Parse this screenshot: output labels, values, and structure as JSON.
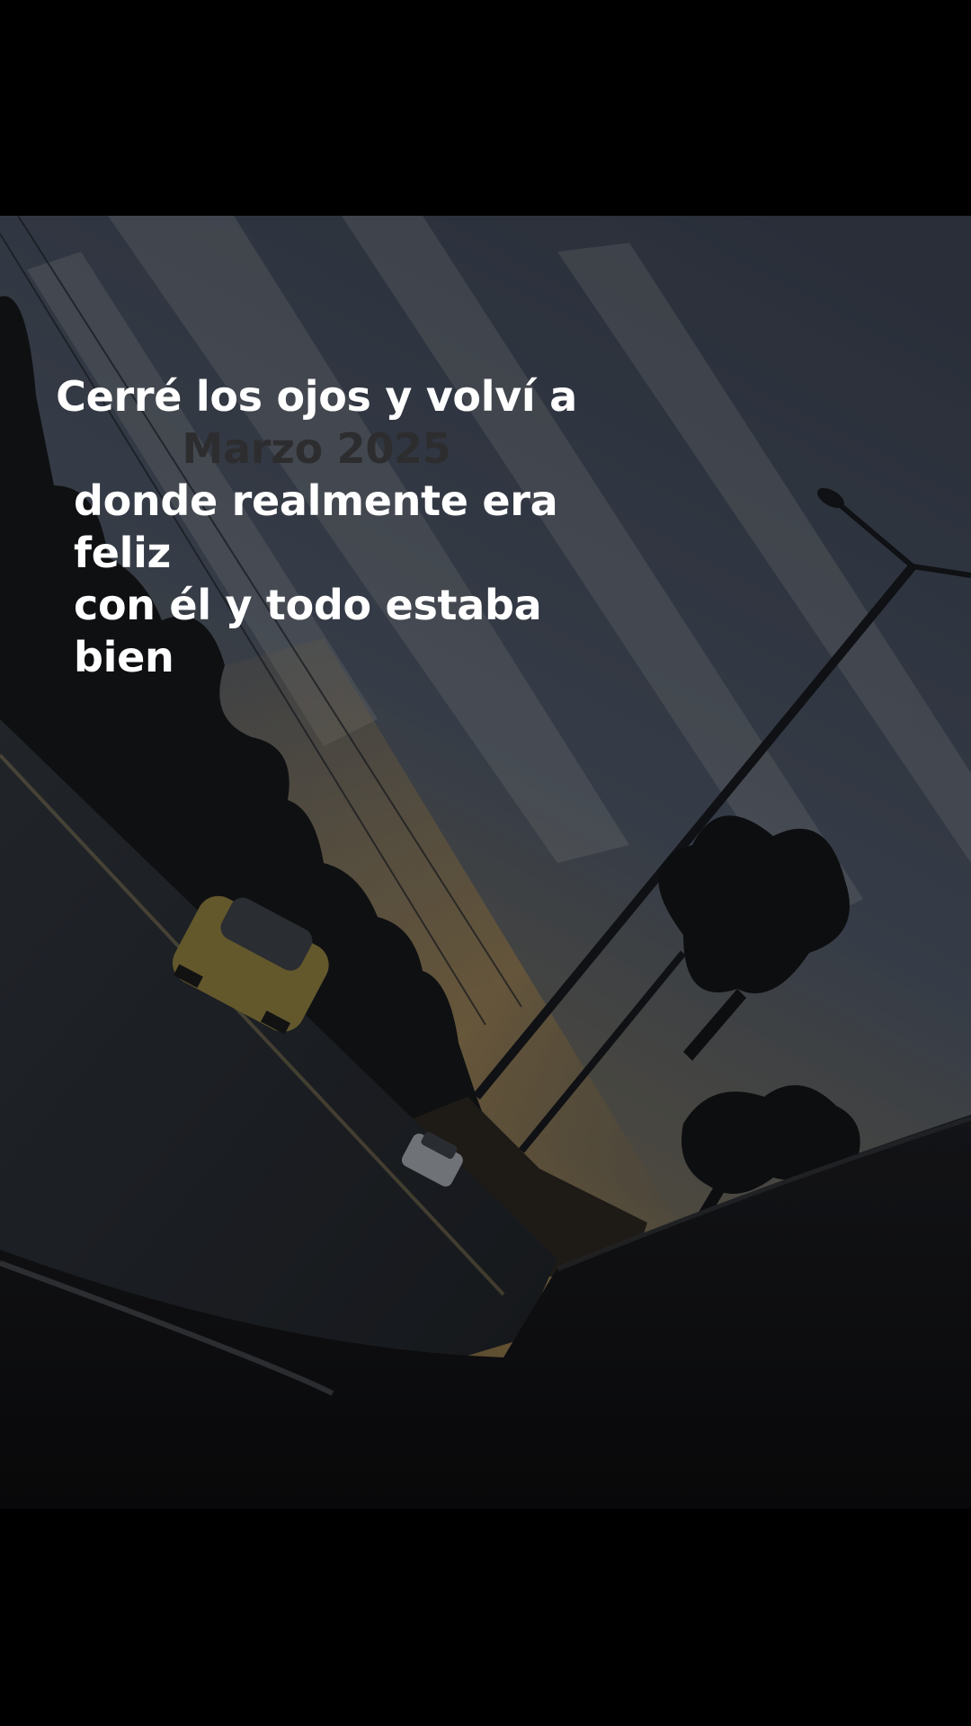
{
  "caption": {
    "line1": "Cerré los ojos y volví a",
    "line2": "Marzo 2025",
    "line3": "donde realmente era feliz",
    "line4": "con él y todo estaba bien"
  },
  "colors": {
    "background": "#000000",
    "sky_top": "#3e4756",
    "sunset_glow": "#a68a54",
    "caption_text": "#ffffff",
    "faded_text": "#2d2d2f"
  }
}
